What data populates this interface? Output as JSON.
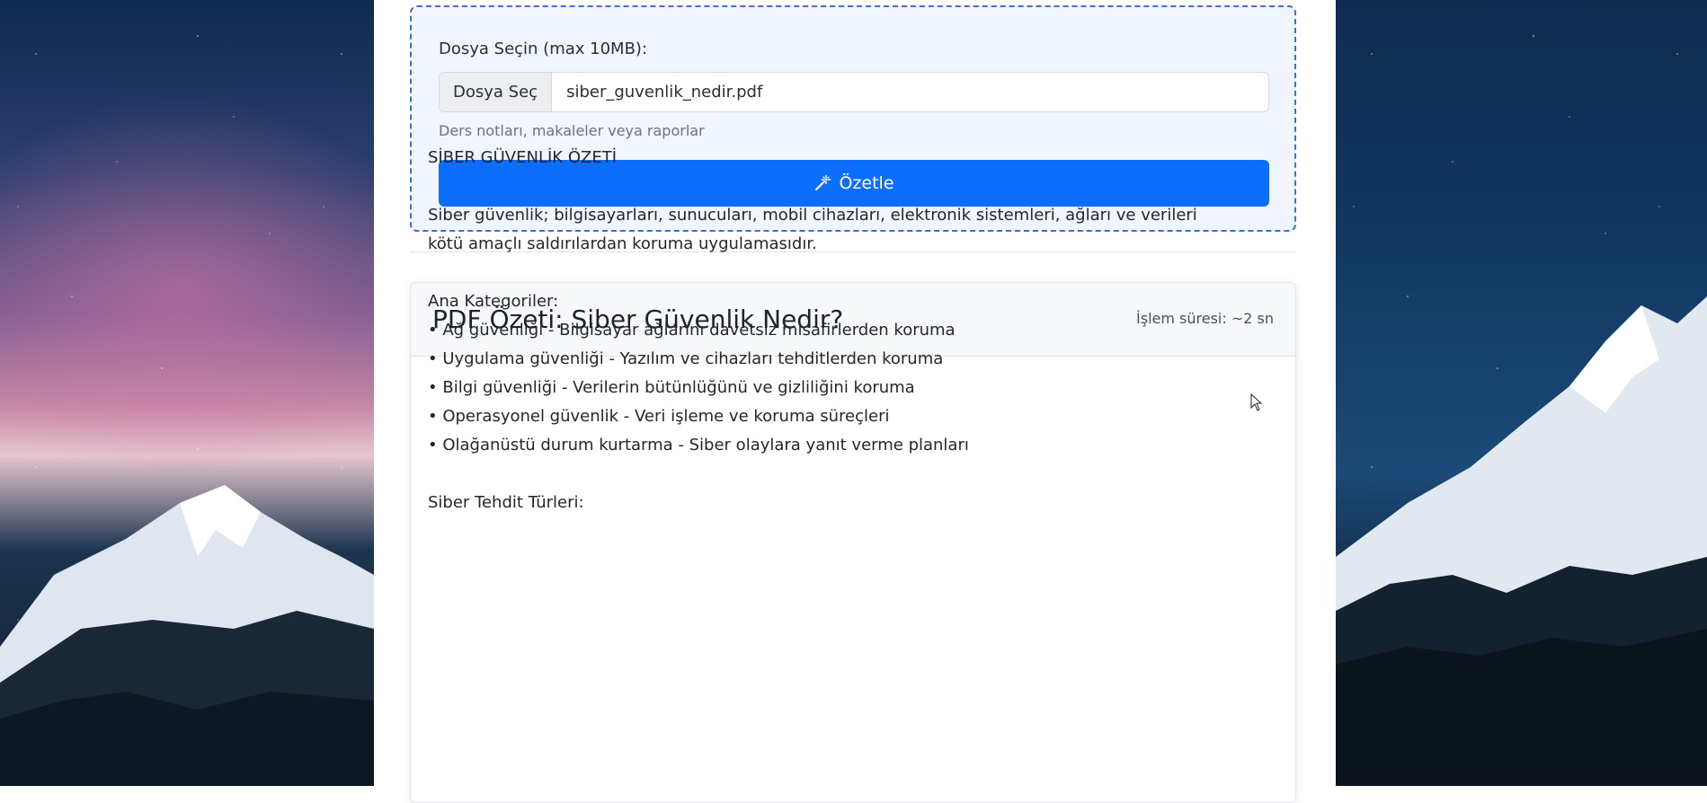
{
  "upload": {
    "label": "Dosya Seçin (max 10MB):",
    "file_button": "Dosya Seç",
    "file_name": "siber_guvenlik_nedir.pdf",
    "help": "Ders notları, makaleler veya raporlar",
    "submit": "Özetle"
  },
  "summary": {
    "title": "PDF Özeti: Siber Güvenlik Nedir?",
    "meta": "İşlem süresi: ~2 sn",
    "heading": "SİBER GÜVENLİK ÖZETİ",
    "intro": "Siber güvenlik; bilgisayarları, sunucuları, mobil cihazları, elektronik sistemleri, ağları ve verileri kötü amaçlı saldırılardan koruma uygulamasıdır.",
    "categories_title": "Ana Kategoriler:",
    "categories": [
      "• Ağ güvenliği - Bilgisayar ağlarını davetsiz misafirlerden koruma",
      "• Uygulama güvenliği - Yazılım ve cihazları tehditlerden koruma",
      "• Bilgi güvenliği - Verilerin bütünlüğünü ve gizliliğini koruma",
      "• Operasyonel güvenlik - Veri işleme ve koruma süreçleri",
      "• Olağanüstü durum kurtarma - Siber olaylara yanıt verme planları"
    ],
    "next_section": "Siber Tehdit Türleri:"
  },
  "icons": {
    "submit_icon": "magic-wand-icon"
  }
}
